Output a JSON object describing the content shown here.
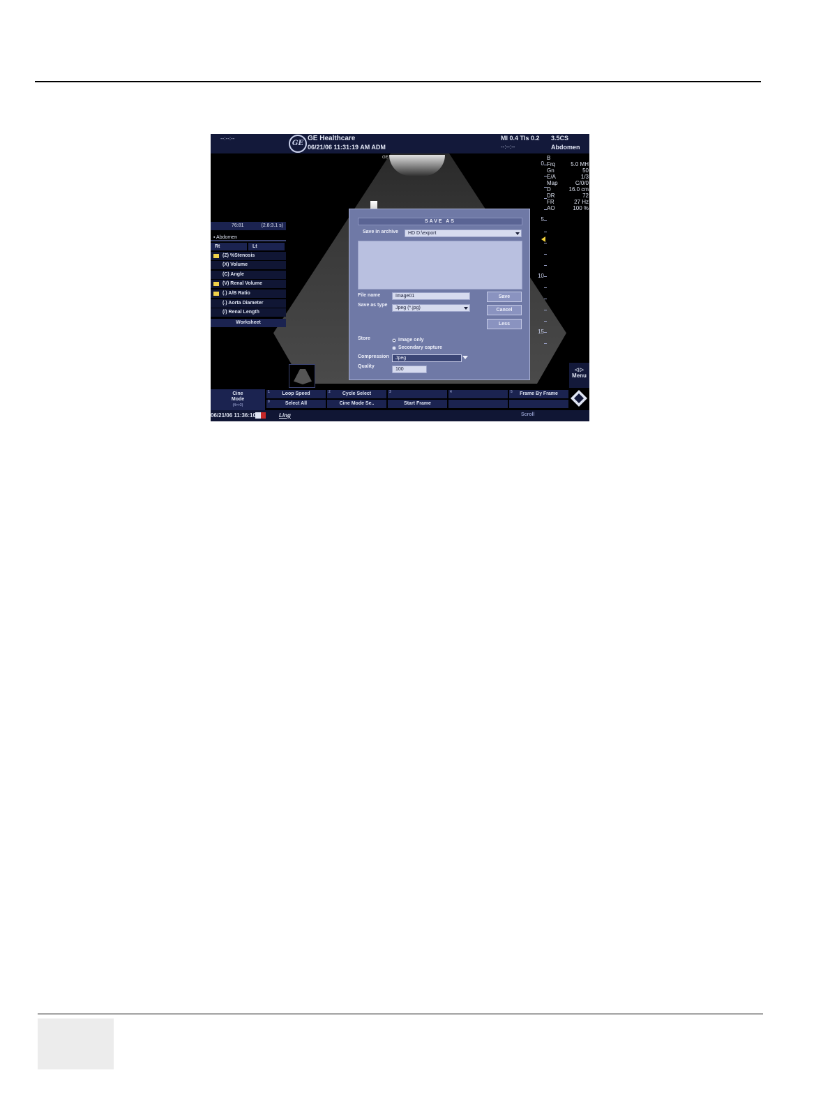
{
  "header": {
    "cine_counter": "--:--:--",
    "brand": "GE Healthcare",
    "datetime": "06/21/06 11:31:19 AM ADM",
    "mi_tis": "MI 0.4   TIs 0.2",
    "elapsed": "--:--:--",
    "probe": "3.5CS",
    "preset": "Abdomen"
  },
  "image": {
    "logo_mark": "GE",
    "depth_marks": [
      "0",
      "5",
      "10",
      "15"
    ],
    "focus_color": "#f5d33a"
  },
  "params": [
    {
      "k": "B",
      "v": ""
    },
    {
      "k": "Frq",
      "v": "5.0 MH"
    },
    {
      "k": "Gn",
      "v": "50"
    },
    {
      "k": "E/A",
      "v": "1/3"
    },
    {
      "k": "Map",
      "v": "C/0/0"
    },
    {
      "k": "D",
      "v": "16.0 cm"
    },
    {
      "k": "DR",
      "v": "72"
    },
    {
      "k": "FR",
      "v": "27 Hz"
    },
    {
      "k": "AO",
      "v": "100 %"
    }
  ],
  "left_panel": {
    "cine_frames": "76:81",
    "cine_time": "(2.8:3.1 s)",
    "exam": "Abdomen",
    "tab_rt": "Rt",
    "tab_lt": "Lt",
    "items": [
      {
        "label": "(Z)  %Stenosis",
        "folder": true
      },
      {
        "label": "(X)  Volume",
        "folder": false
      },
      {
        "label": "(C)  Angle",
        "folder": false
      },
      {
        "label": "(V)  Renal Volume",
        "folder": true
      },
      {
        "label": "(.)  A/B Ratio",
        "folder": true
      },
      {
        "label": "(.)  Aorta Diameter",
        "folder": false
      },
      {
        "label": "(/)  Renal Length",
        "folder": false
      }
    ],
    "worksheet": "Worksheet"
  },
  "dialog": {
    "title": "SAVE AS",
    "save_in_label": "Save in archive",
    "save_in_value": "HD   D:\\export",
    "file_name_label": "File name",
    "file_name_value": "Image01",
    "save_type_label": "Save as type",
    "save_type_value": "Jpeg  (*.jpg)",
    "save_button": "Save",
    "cancel_button": "Cancel",
    "less_button": "Less",
    "store_label": "Store",
    "store_options": [
      "Image only",
      "Secondary capture"
    ],
    "store_selected": "Image only",
    "compression_label": "Compression",
    "compression_value": "Jpeg",
    "quality_label": "Quality",
    "quality_value": "100"
  },
  "softkeys": {
    "cine_mode_l1": "Cine",
    "cine_mode_l2": "Mode",
    "cine_mode_sub": "(4>>3)",
    "top": [
      {
        "num": "1",
        "label": "Loop Speed"
      },
      {
        "num": "2",
        "label": "Cycle Select"
      },
      {
        "num": "3",
        "label": ""
      },
      {
        "num": "4",
        "label": ""
      },
      {
        "num": "5",
        "label": "Frame By Frame"
      }
    ],
    "bottom": [
      {
        "num": "0",
        "label": "Select All"
      },
      {
        "num": "",
        "label": "Cine Mode Se.."
      },
      {
        "num": "",
        "label": "Start Frame"
      },
      {
        "num": "",
        "label": ""
      },
      {
        "num": "",
        "label": ""
      }
    ]
  },
  "menu_label": "Menu",
  "status": {
    "datetime": "06/21/06 11:36:10",
    "app": "Ling",
    "scroll": "Scroll"
  }
}
